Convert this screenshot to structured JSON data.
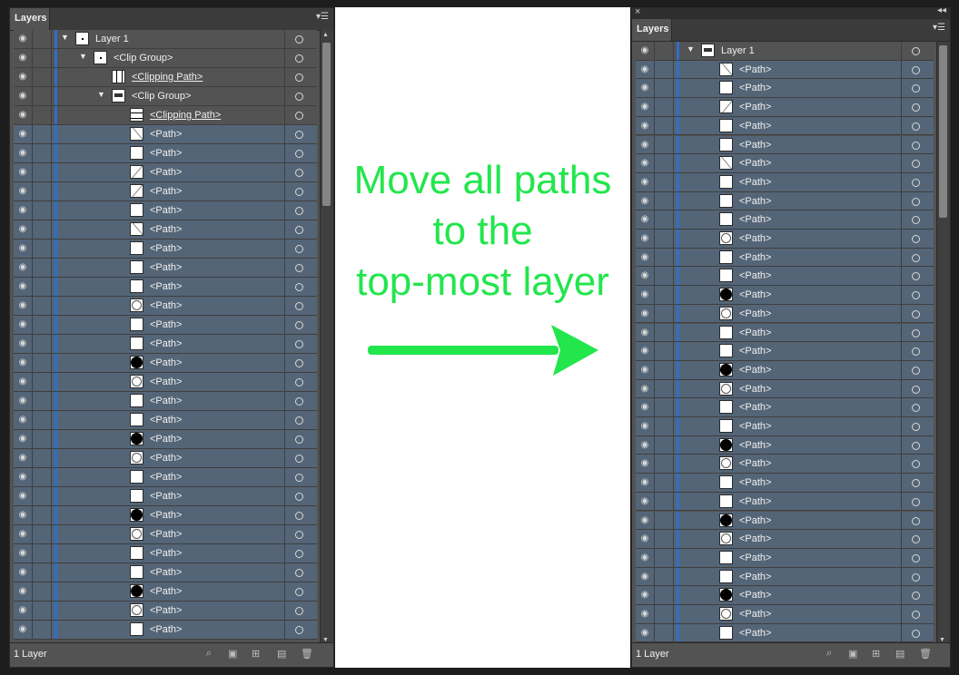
{
  "left_panel": {
    "tab": "Layers",
    "footer_count": "1 Layer",
    "rows": [
      {
        "label": "Layer 1",
        "indent": 0,
        "thumb": "dot",
        "tri": true,
        "kind": "layer"
      },
      {
        "label": "<Clip Group>",
        "indent": 1,
        "thumb": "dot",
        "tri": true,
        "kind": "group"
      },
      {
        "label": "<Clipping Path>",
        "indent": 2,
        "thumb": "vbar",
        "tri": false,
        "kind": "clip",
        "underline": true
      },
      {
        "label": "<Clip Group>",
        "indent": 2,
        "thumb": "img",
        "tri": true,
        "kind": "group"
      },
      {
        "label": "<Clipping Path>",
        "indent": 3,
        "thumb": "hbar",
        "tri": false,
        "kind": "clip",
        "underline": true
      },
      {
        "label": "<Path>",
        "indent": 3,
        "thumb": "line"
      },
      {
        "label": "<Path>",
        "indent": 3,
        "thumb": "blank"
      },
      {
        "label": "<Path>",
        "indent": 3,
        "thumb": "line2"
      },
      {
        "label": "<Path>",
        "indent": 3,
        "thumb": "line2"
      },
      {
        "label": "<Path>",
        "indent": 3,
        "thumb": "blank"
      },
      {
        "label": "<Path>",
        "indent": 3,
        "thumb": "line"
      },
      {
        "label": "<Path>",
        "indent": 3,
        "thumb": "blank"
      },
      {
        "label": "<Path>",
        "indent": 3,
        "thumb": "blank"
      },
      {
        "label": "<Path>",
        "indent": 3,
        "thumb": "blank"
      },
      {
        "label": "<Path>",
        "indent": 3,
        "thumb": "circle"
      },
      {
        "label": "<Path>",
        "indent": 3,
        "thumb": "blank"
      },
      {
        "label": "<Path>",
        "indent": 3,
        "thumb": "blank"
      },
      {
        "label": "<Path>",
        "indent": 3,
        "thumb": "filled"
      },
      {
        "label": "<Path>",
        "indent": 3,
        "thumb": "circle"
      },
      {
        "label": "<Path>",
        "indent": 3,
        "thumb": "blank"
      },
      {
        "label": "<Path>",
        "indent": 3,
        "thumb": "blank"
      },
      {
        "label": "<Path>",
        "indent": 3,
        "thumb": "filled"
      },
      {
        "label": "<Path>",
        "indent": 3,
        "thumb": "circle"
      },
      {
        "label": "<Path>",
        "indent": 3,
        "thumb": "blank"
      },
      {
        "label": "<Path>",
        "indent": 3,
        "thumb": "blank"
      },
      {
        "label": "<Path>",
        "indent": 3,
        "thumb": "filled"
      },
      {
        "label": "<Path>",
        "indent": 3,
        "thumb": "circle"
      },
      {
        "label": "<Path>",
        "indent": 3,
        "thumb": "blank"
      },
      {
        "label": "<Path>",
        "indent": 3,
        "thumb": "blank"
      },
      {
        "label": "<Path>",
        "indent": 3,
        "thumb": "filled"
      },
      {
        "label": "<Path>",
        "indent": 3,
        "thumb": "circle"
      },
      {
        "label": "<Path>",
        "indent": 3,
        "thumb": "blank"
      },
      {
        "label": "<Path>",
        "indent": 3,
        "thumb": "blank"
      }
    ]
  },
  "right_panel": {
    "tab": "Layers",
    "footer_count": "1 Layer",
    "rows": [
      {
        "label": "Layer 1",
        "indent": 0,
        "thumb": "img",
        "tri": true,
        "kind": "layer"
      },
      {
        "label": "<Path>",
        "indent": 1,
        "thumb": "line"
      },
      {
        "label": "<Path>",
        "indent": 1,
        "thumb": "blank"
      },
      {
        "label": "<Path>",
        "indent": 1,
        "thumb": "line2"
      },
      {
        "label": "<Path>",
        "indent": 1,
        "thumb": "blank"
      },
      {
        "label": "<Path>",
        "indent": 1,
        "thumb": "blank"
      },
      {
        "label": "<Path>",
        "indent": 1,
        "thumb": "line"
      },
      {
        "label": "<Path>",
        "indent": 1,
        "thumb": "blank"
      },
      {
        "label": "<Path>",
        "indent": 1,
        "thumb": "blank"
      },
      {
        "label": "<Path>",
        "indent": 1,
        "thumb": "blank"
      },
      {
        "label": "<Path>",
        "indent": 1,
        "thumb": "circle"
      },
      {
        "label": "<Path>",
        "indent": 1,
        "thumb": "blank"
      },
      {
        "label": "<Path>",
        "indent": 1,
        "thumb": "blank"
      },
      {
        "label": "<Path>",
        "indent": 1,
        "thumb": "filled"
      },
      {
        "label": "<Path>",
        "indent": 1,
        "thumb": "circle"
      },
      {
        "label": "<Path>",
        "indent": 1,
        "thumb": "blank"
      },
      {
        "label": "<Path>",
        "indent": 1,
        "thumb": "blank"
      },
      {
        "label": "<Path>",
        "indent": 1,
        "thumb": "filled"
      },
      {
        "label": "<Path>",
        "indent": 1,
        "thumb": "circle"
      },
      {
        "label": "<Path>",
        "indent": 1,
        "thumb": "blank"
      },
      {
        "label": "<Path>",
        "indent": 1,
        "thumb": "blank"
      },
      {
        "label": "<Path>",
        "indent": 1,
        "thumb": "filled"
      },
      {
        "label": "<Path>",
        "indent": 1,
        "thumb": "circle"
      },
      {
        "label": "<Path>",
        "indent": 1,
        "thumb": "blank"
      },
      {
        "label": "<Path>",
        "indent": 1,
        "thumb": "blank"
      },
      {
        "label": "<Path>",
        "indent": 1,
        "thumb": "filled"
      },
      {
        "label": "<Path>",
        "indent": 1,
        "thumb": "circle"
      },
      {
        "label": "<Path>",
        "indent": 1,
        "thumb": "blank"
      },
      {
        "label": "<Path>",
        "indent": 1,
        "thumb": "blank"
      },
      {
        "label": "<Path>",
        "indent": 1,
        "thumb": "filled"
      },
      {
        "label": "<Path>",
        "indent": 1,
        "thumb": "circle"
      },
      {
        "label": "<Path>",
        "indent": 1,
        "thumb": "blank"
      },
      {
        "label": "<Path>",
        "indent": 1,
        "thumb": "blank"
      }
    ]
  },
  "annotation": {
    "lines": [
      "Move all paths",
      "to the",
      "top-most layer"
    ],
    "color": "#22e64c"
  },
  "icons": {
    "eye": "eye-icon",
    "target": "target-icon",
    "footer": [
      "locate-object-icon",
      "make-clipping-mask-icon",
      "create-sublayer-icon",
      "new-layer-icon",
      "trash-icon"
    ]
  },
  "colors": {
    "layer_color": "#2f6ec7",
    "selected_row": "#546577",
    "panel_bg": "#535353"
  }
}
